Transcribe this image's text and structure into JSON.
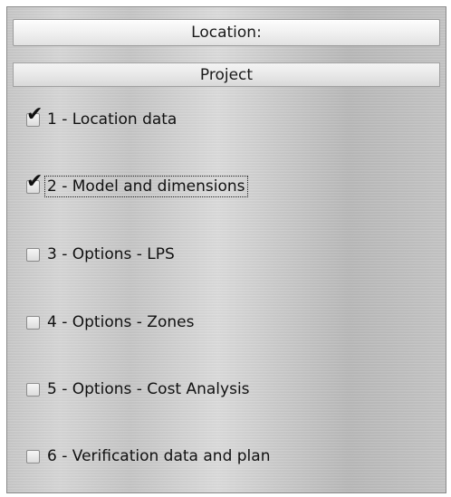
{
  "header": {
    "location_label": "Location:"
  },
  "section": {
    "title": "Project"
  },
  "items": [
    {
      "label": "1 - Location data",
      "checked": true,
      "focused": false
    },
    {
      "label": "2 - Model and dimensions",
      "checked": true,
      "focused": true
    },
    {
      "label": "3 - Options - LPS",
      "checked": false,
      "focused": false
    },
    {
      "label": "4 - Options - Zones",
      "checked": false,
      "focused": false
    },
    {
      "label": "5 - Options - Cost Analysis",
      "checked": false,
      "focused": false
    },
    {
      "label": "6 - Verification data and plan",
      "checked": false,
      "focused": false
    }
  ],
  "icons": {
    "checkmark": "check-icon"
  }
}
